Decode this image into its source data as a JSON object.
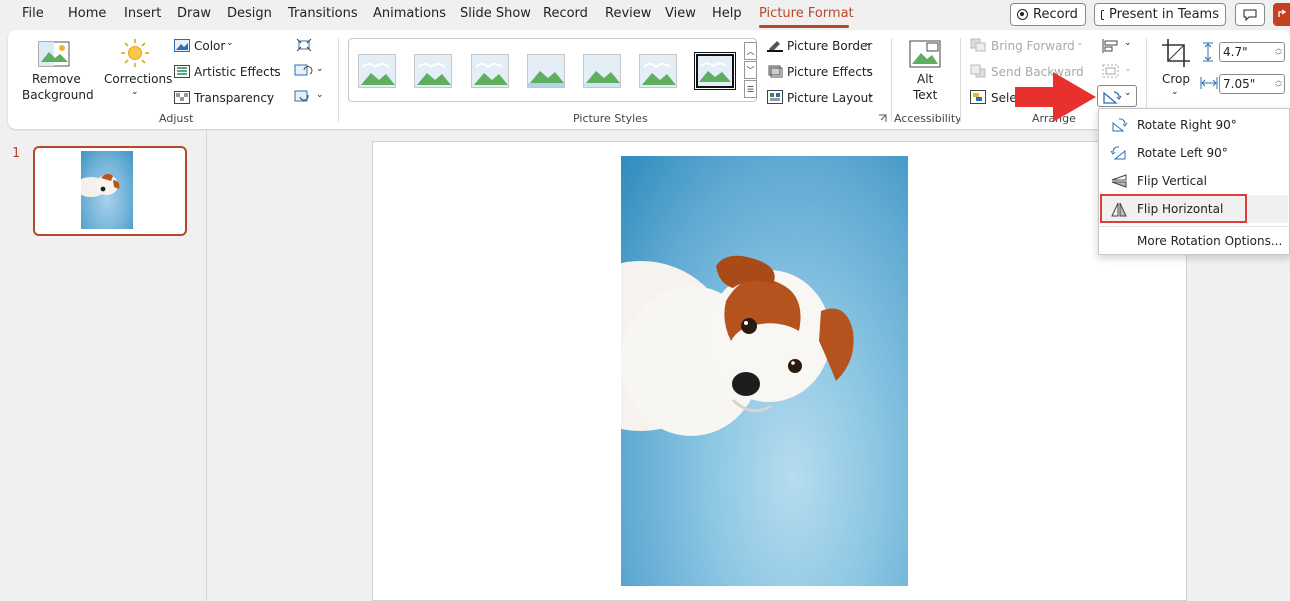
{
  "tabs": [
    {
      "label": "File"
    },
    {
      "label": "Home"
    },
    {
      "label": "Insert"
    },
    {
      "label": "Draw"
    },
    {
      "label": "Design"
    },
    {
      "label": "Transitions"
    },
    {
      "label": "Animations"
    },
    {
      "label": "Slide Show"
    },
    {
      "label": "Record"
    },
    {
      "label": "Review"
    },
    {
      "label": "View"
    },
    {
      "label": "Help"
    },
    {
      "label": "Picture Format"
    }
  ],
  "topbar": {
    "record_label": "Record",
    "present_label": "Present in Teams"
  },
  "adjust": {
    "remove_background_l1": "Remove",
    "remove_background_l2": "Background",
    "corrections": "Corrections",
    "color": "Color",
    "artistic_effects": "Artistic Effects",
    "transparency": "Transparency",
    "group_label": "Adjust"
  },
  "styles": {
    "picture_border": "Picture Border",
    "picture_effects": "Picture Effects",
    "picture_layout": "Picture Layout",
    "group_label": "Picture Styles"
  },
  "accessibility": {
    "alt_l1": "Alt",
    "alt_l2": "Text",
    "group_label": "Accessibility"
  },
  "arrange": {
    "bring_forward": "Bring Forward",
    "send_backward": "Send Backward",
    "selection_pane": "Sele",
    "group_label": "Arrange"
  },
  "size": {
    "crop": "Crop",
    "height": "4.7\"",
    "width": "7.05\""
  },
  "slides": {
    "number": "1"
  },
  "rotate_menu": {
    "items": [
      {
        "label": "Rotate Right 90°"
      },
      {
        "label": "Rotate Left 90°"
      },
      {
        "label": "Flip Vertical"
      },
      {
        "label": "Flip Horizontal"
      },
      {
        "label": "More Rotation Options..."
      }
    ]
  },
  "colors": {
    "accent": "#b7472a",
    "highlight": "#e03c3c"
  }
}
